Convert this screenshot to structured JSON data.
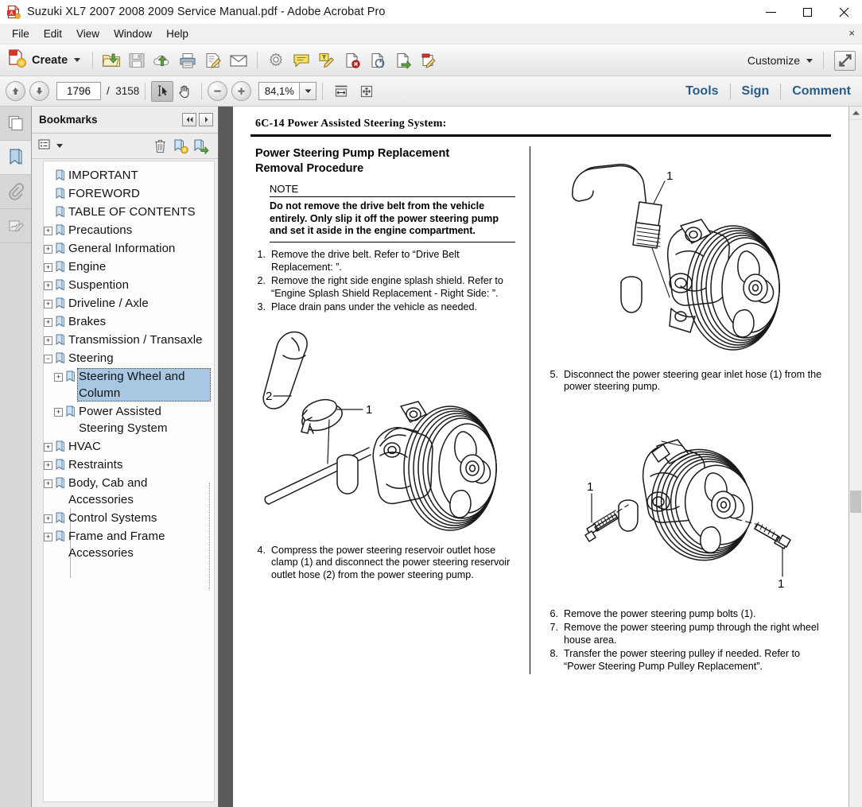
{
  "window": {
    "title": "Suzuki XL7 2007 2008 2009 Service Manual.pdf - Adobe Acrobat Pro",
    "app_icon": "acrobat-pdf-icon",
    "minimize": "minimize-icon",
    "maximize": "maximize-icon",
    "close": "close-icon"
  },
  "menubar": {
    "items": [
      {
        "label": "File"
      },
      {
        "label": "Edit"
      },
      {
        "label": "View"
      },
      {
        "label": "Window"
      },
      {
        "label": "Help"
      }
    ],
    "close_document": "×"
  },
  "toolbar": {
    "create_label": "Create",
    "create_icon": "create-pdf-icon",
    "icons": [
      {
        "name": "open-folder-icon"
      },
      {
        "name": "save-icon"
      },
      {
        "name": "upload-cloud-icon"
      },
      {
        "name": "print-icon"
      },
      {
        "name": "sign-document-icon"
      },
      {
        "name": "email-icon"
      },
      {
        "name": "settings-gear-icon"
      },
      {
        "name": "sticky-note-comment-icon"
      },
      {
        "name": "highlight-text-icon"
      },
      {
        "name": "delete-pages-icon"
      },
      {
        "name": "extract-pages-icon"
      },
      {
        "name": "replace-pages-icon"
      },
      {
        "name": "edit-document-icon"
      }
    ],
    "customize_label": "Customize",
    "fullscreen_icon": "fullscreen-icon"
  },
  "navbar": {
    "previous_page_icon": "arrow-up-icon",
    "next_page_icon": "arrow-down-icon",
    "current_page": "1796",
    "page_separator": "/",
    "total_pages": "3158",
    "select_tool_icon": "select-text-icon",
    "hand_tool_icon": "hand-icon",
    "zoom_out_icon": "zoom-out-icon",
    "zoom_in_icon": "zoom-in-icon",
    "zoom_level": "84,1%",
    "zoom_dropdown_icon": "chevron-down-icon",
    "fit_width_icon": "fit-width-icon",
    "fit_page_icon": "fit-page-icon",
    "right_links": [
      {
        "label": "Tools"
      },
      {
        "label": "Sign"
      },
      {
        "label": "Comment"
      }
    ]
  },
  "rail": {
    "items": [
      {
        "name": "page-thumbnails-icon",
        "active": false
      },
      {
        "name": "bookmarks-icon",
        "active": true
      },
      {
        "name": "attachments-paperclip-icon",
        "active": false
      },
      {
        "name": "signatures-icon",
        "active": false
      }
    ]
  },
  "bookmarks_panel": {
    "title": "Bookmarks",
    "collapse_icon": "double-chevron-left-icon",
    "expand_icon": "chevron-right-icon",
    "options_icon": "options-list-icon",
    "options_caret_icon": "chevron-down-icon",
    "delete_icon": "trash-icon",
    "new_bookmark_icon": "new-bookmark-icon",
    "goto_bookmark_icon": "goto-bookmark-icon",
    "items": [
      {
        "label": "IMPORTANT",
        "indent": 0,
        "toggle": "none",
        "selected": false
      },
      {
        "label": "FOREWORD",
        "indent": 0,
        "toggle": "none",
        "selected": false
      },
      {
        "label": "TABLE OF CONTENTS",
        "indent": 0,
        "toggle": "none",
        "selected": false
      },
      {
        "label": "Precautions",
        "indent": 0,
        "toggle": "plus",
        "selected": false
      },
      {
        "label": "General Information",
        "indent": 0,
        "toggle": "plus",
        "selected": false
      },
      {
        "label": "Engine",
        "indent": 0,
        "toggle": "plus",
        "selected": false
      },
      {
        "label": "Suspention",
        "indent": 0,
        "toggle": "plus",
        "selected": false
      },
      {
        "label": "Driveline / Axle",
        "indent": 0,
        "toggle": "plus",
        "selected": false
      },
      {
        "label": "Brakes",
        "indent": 0,
        "toggle": "plus",
        "selected": false
      },
      {
        "label": "Transmission / Transaxle",
        "indent": 0,
        "toggle": "plus",
        "selected": false
      },
      {
        "label": "Steering",
        "indent": 0,
        "toggle": "minus",
        "selected": false
      },
      {
        "label": "Steering Wheel and Column",
        "indent": 1,
        "toggle": "plus",
        "selected": true
      },
      {
        "label": "Power Assisted Steering System",
        "indent": 1,
        "toggle": "plus",
        "selected": false
      },
      {
        "label": "HVAC",
        "indent": 0,
        "toggle": "plus",
        "selected": false
      },
      {
        "label": "Restraints",
        "indent": 0,
        "toggle": "plus",
        "selected": false
      },
      {
        "label": "Body, Cab and Accessories",
        "indent": 0,
        "toggle": "plus",
        "selected": false
      },
      {
        "label": "Control Systems",
        "indent": 0,
        "toggle": "plus",
        "selected": false
      },
      {
        "label": "Frame and Frame Accessories",
        "indent": 0,
        "toggle": "plus",
        "selected": false
      }
    ]
  },
  "document": {
    "running_head": "6C-14   Power Assisted Steering System:",
    "section_title_line1": "Power Steering Pump Replacement",
    "section_title_line2": "Removal Procedure",
    "note_label": "NOTE",
    "note_body": "Do not remove the drive belt from the vehicle entirely. Only slip it off the power steering pump and set it aside in the engine compartment.",
    "steps_left": [
      {
        "num": "1.",
        "text": "Remove the drive belt. Refer to “Drive Belt Replacement: ”."
      },
      {
        "num": "2.",
        "text": "Remove the right side engine splash shield. Refer to “Engine Splash Shield Replacement - Right Side: ”."
      },
      {
        "num": "3.",
        "text": "Place drain pans under the vehicle as needed."
      }
    ],
    "step_4": {
      "num": "4.",
      "text": "Compress the power steering reservoir outlet hose clamp (1) and disconnect the power steering reservoir outlet hose (2) from the power steering pump."
    },
    "steps_right_top": [
      {
        "num": "5.",
        "text": "Disconnect the power steering gear inlet hose (1) from the power steering pump."
      }
    ],
    "steps_right_bottom": [
      {
        "num": "6.",
        "text": "Remove the power steering pump bolts (1)."
      },
      {
        "num": "7.",
        "text": "Remove the power steering pump through the right wheel house area."
      },
      {
        "num": "8.",
        "text": "Transfer the power steering pulley if needed. Refer to “Power Steering Pump Pulley Replacement”."
      }
    ],
    "figures": [
      {
        "name": "figure-pump-inlet-hose",
        "callouts": [
          "1"
        ]
      },
      {
        "name": "figure-reservoir-outlet-hose",
        "callouts": [
          "1",
          "2"
        ]
      },
      {
        "name": "figure-pump-bolts",
        "callouts": [
          "1",
          "1"
        ]
      }
    ]
  },
  "colors": {
    "accent_link": "#2b5c88",
    "selection": "#a7c7e2",
    "titlebar_bg": "#ffffff",
    "toolbar_bg": "#ededed",
    "panel_bg": "#ededed",
    "rail_bg": "#d7d7d7",
    "doc_gutter": "#5a5a5a"
  },
  "scrollbars": {
    "doc_up_arrow_icon": "chevron-up-icon"
  }
}
